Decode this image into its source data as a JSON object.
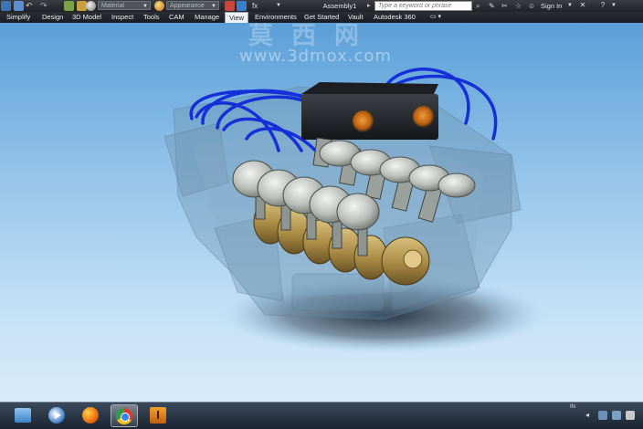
{
  "title_bar": {
    "material_dropdown": "Material",
    "appearance_dropdown": "Appearance",
    "document_title": "Assembly1",
    "search_placeholder": "Type a keyword or phrase",
    "sign_in": "Sign In"
  },
  "ribbon_tabs": [
    {
      "label": "Simplify"
    },
    {
      "label": "Design"
    },
    {
      "label": "3D Model"
    },
    {
      "label": "Inspect"
    },
    {
      "label": "Tools"
    },
    {
      "label": "CAM"
    },
    {
      "label": "Manage"
    },
    {
      "label": "View"
    },
    {
      "label": "Environments"
    },
    {
      "label": "Get Started"
    },
    {
      "label": "Vault"
    },
    {
      "label": "Autodesk 360"
    }
  ],
  "active_tab": "View",
  "watermark": {
    "chinese": "莫西网",
    "url": "www.3dmox.com"
  },
  "taskbar": {
    "apps": [
      "file-explorer-icon",
      "media-player-icon",
      "firefox-icon",
      "chrome-icon",
      "autodesk-inventor-icon"
    ],
    "active_app": "chrome-icon",
    "tray_indicator": "IN"
  },
  "colors": {
    "viewport_top": "#5a9fd8",
    "viewport_bottom": "#d8ecf9",
    "wire_blue": "#1530d8",
    "brass": "#b89a55",
    "piston_gray": "#d0d3cf",
    "ecu_black": "#2a2d31",
    "connector_orange": "#d5781c"
  }
}
